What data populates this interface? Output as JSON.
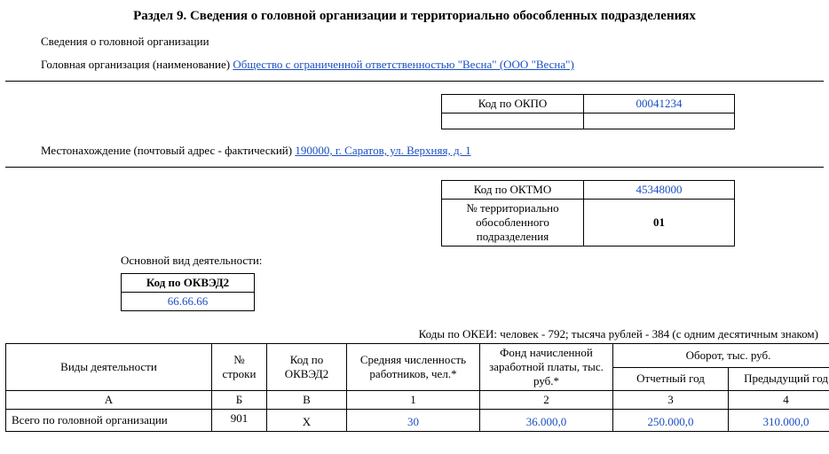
{
  "section": {
    "title": "Раздел 9. Сведения о головной организации и территориально обособленных подразделениях",
    "subtitle": "Сведения о головной организации",
    "org_label": "Головная организация (наименование) ",
    "org_name": "Общество с ограниченной ответственностью \"Весна\" (ООО \"Весна\")",
    "address_label": "Местонахождение (почтовый адрес - фактический) ",
    "address_value": "190000, г. Саратов, ул. Верхняя, д. 1",
    "main_activity_label": "Основной вид деятельности:"
  },
  "okpo": {
    "label": "Код по ОКПО",
    "value": "00041234"
  },
  "oktmo": {
    "label": "Код по ОКТМО",
    "value": "45348000",
    "division_label": "№ территориально обособленного подразделения",
    "division_value": "01"
  },
  "okved": {
    "header": "Код по ОКВЭД2",
    "value": "66.66.66"
  },
  "okei_note": "Коды по ОКЕИ: человек - 792; тысяча рублей - 384 (с одним десятичным знаком)",
  "activity_table": {
    "headers": {
      "a": "Виды деятельности",
      "b": "№ строки",
      "v": "Код по ОКВЭД2",
      "c1": "Средняя численность работников, чел.*",
      "c2": "Фонд начисленной заработной платы, тыс. руб.*",
      "turnover": "Оборот, тыс. руб.",
      "c3": "Отчетный год",
      "c4": "Предыдущий год"
    },
    "letters": {
      "a": "А",
      "b": "Б",
      "v": "В",
      "c1": "1",
      "c2": "2",
      "c3": "3",
      "c4": "4"
    },
    "rows": [
      {
        "name": "Всего по головной организации",
        "line_no": "901",
        "okved": "Х",
        "avg_workers": "30",
        "payroll": "36.000,0",
        "turnover_report": "250.000,0",
        "turnover_prev": "310.000,0"
      }
    ]
  }
}
